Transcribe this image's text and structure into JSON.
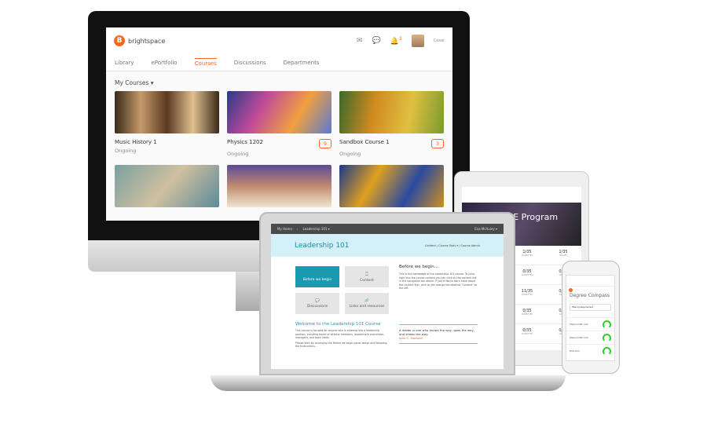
{
  "desktop": {
    "brand": "brightspace",
    "user": "Cesar",
    "notification_count": "3",
    "nav": [
      "Library",
      "ePortfolio",
      "Courses",
      "Discussions",
      "Departments"
    ],
    "active_nav": "Courses",
    "section": "My Courses",
    "courses": [
      {
        "name": "Music History 1",
        "status": "Ongoing",
        "badge": ""
      },
      {
        "name": "Physics 1202",
        "status": "Ongoing",
        "badge": "9"
      },
      {
        "name": "Sandbox Course 1",
        "status": "Ongoing",
        "badge": "3"
      }
    ]
  },
  "laptop": {
    "breadcrumb": [
      "My Home",
      "Leadership 101 ▾"
    ],
    "user": "Eva McAuley ▾",
    "title": "Leadership 101",
    "menu": "Content | Course Tools ▾ | Course Admin",
    "tiles": [
      "Before we begin",
      "Content",
      "Discussions",
      "Links and resources"
    ],
    "before_title": "Before we begin...",
    "before_text": "This is the homepage of the Leadership 101 course. To jump right into the course content you can click on the content link in the navigation bar above. If you'd like to learn more about the content first, click on the orange tab labelled \"Content\" to the left.",
    "welcome_title": "Welcome to the Leadership 101 Course",
    "welcome_text": "This course is focused for anyone who is entering into a leadership position, including board of director members, department executives, managers, and team leads.",
    "welcome_text2": "Please start by accessing the Before we begin panel above and following the instructions.",
    "quote": "A leader is one who knows the way, goes the way, and shows the way.",
    "quote_author": "John C. Maxwell"
  },
  "tablet": {
    "title": "CBE Program",
    "rows": [
      [
        "1/35",
        "1/35"
      ],
      [
        "0/35",
        "0/35"
      ],
      [
        "11/35",
        "0/35"
      ],
      [
        "0/35",
        "0/35"
      ],
      [
        "0/35",
        "0/35"
      ]
    ],
    "sub": [
      "SUBMITTED",
      "GRADED"
    ]
  },
  "phone": {
    "title": "Degree Compass",
    "filter": "Filter by Requirement",
    "rows": [
      "ENGLCOMP 100",
      "ENGLCOMP 200",
      "BIOLOGY"
    ]
  },
  "colors": {
    "accent": "#f26a21",
    "teal": "#1a9ab0"
  }
}
